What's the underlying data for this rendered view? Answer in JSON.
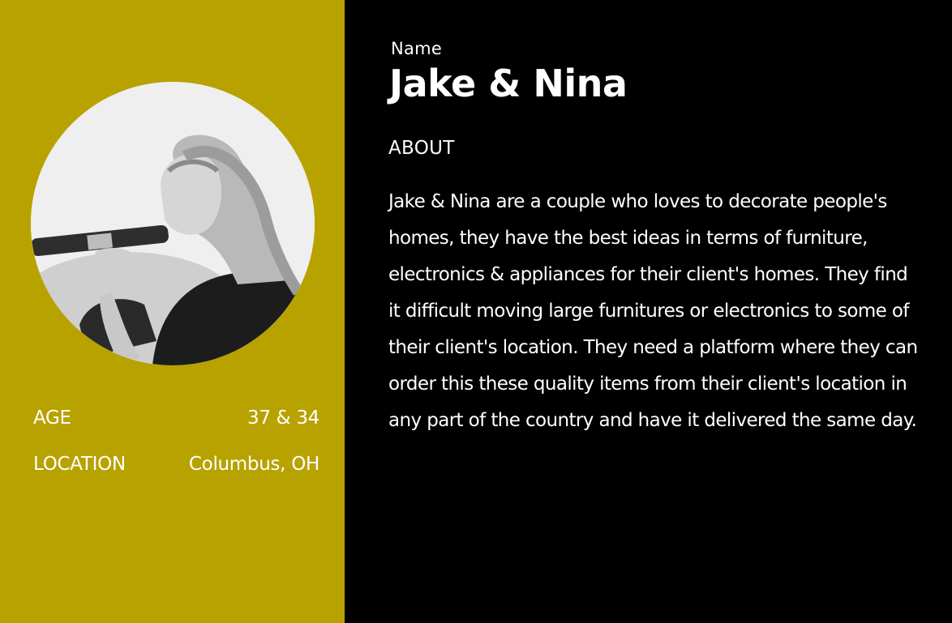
{
  "persona": {
    "name_label": "Name",
    "name": "Jake & Nina",
    "about_heading": "ABOUT",
    "about_text": "Jake & Nina are a couple who loves to decorate people's homes, they have the best ideas in terms of furniture, electronics & appliances for their client's homes. They find it difficult moving large furnitures or electronics to some of their client's location. They need a platform where they can order this these quality items from their client's location in any part of the country and have it delivered the same day.",
    "stats": {
      "age_label": "AGE",
      "age_value": "37 & 34",
      "location_label": "LOCATION",
      "location_value": "Columbus, OH"
    },
    "photo_icon": "persona-photo"
  },
  "colors": {
    "left_panel": "#b8a200",
    "right_panel": "#000000",
    "text": "#ffffff"
  }
}
